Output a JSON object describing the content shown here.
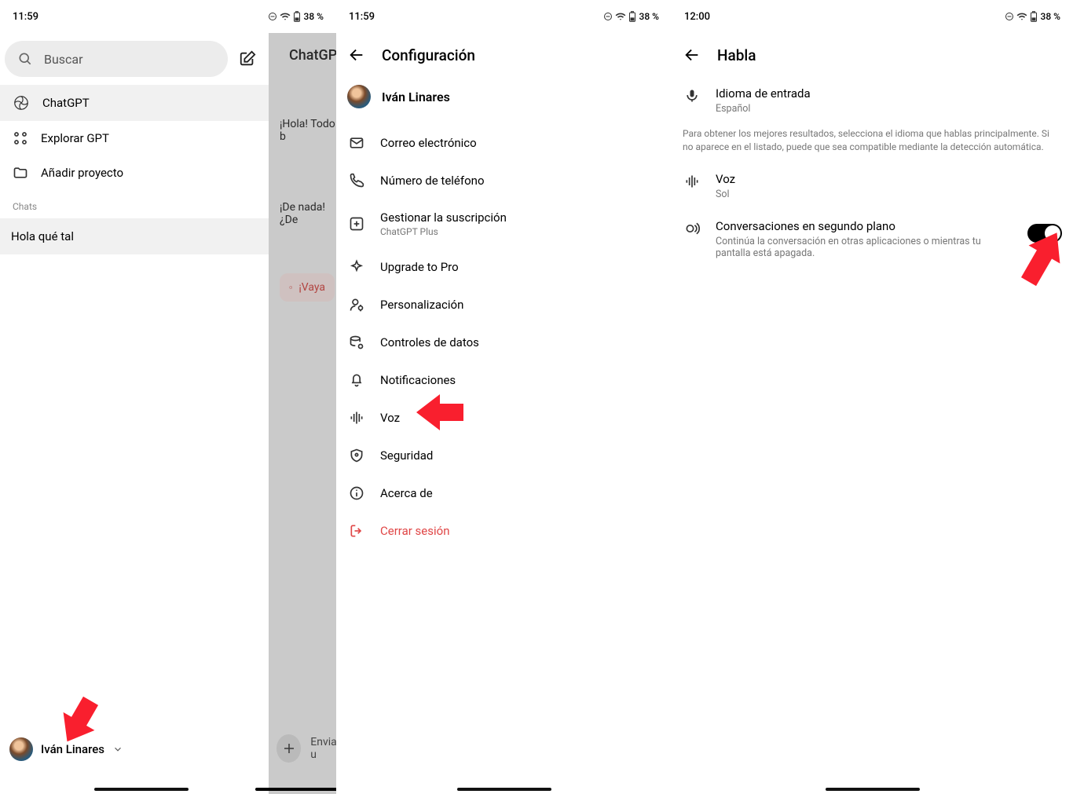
{
  "status": {
    "time1": "11:59",
    "time2": "11:59",
    "time3": "12:00",
    "battery": "38 %"
  },
  "screen1": {
    "search_placeholder": "Buscar",
    "nav": {
      "chatgpt": "ChatGPT",
      "explore": "Explorar GPT",
      "add_project": "Añadir proyecto"
    },
    "chats_label": "Chats",
    "chat_items": [
      "Hola qué tal"
    ],
    "user_name": "Iván Linares",
    "peek": {
      "header": "ChatGPT",
      "msg1": "¡Hola! Todo b",
      "msg2": "¡De nada! ¿De",
      "error": "¡Vaya",
      "input_placeholder": "Enviar u"
    }
  },
  "screen2": {
    "title": "Configuración",
    "user_name": "Iván Linares",
    "items": {
      "email": "Correo electrónico",
      "phone": "Número de teléfono",
      "subscription": "Gestionar la suscripción",
      "subscription_sub": "ChatGPT Plus",
      "upgrade": "Upgrade to Pro",
      "personalization": "Personalización",
      "data_controls": "Controles de datos",
      "notifications": "Notificaciones",
      "voice": "Voz",
      "security": "Seguridad",
      "about": "Acerca de",
      "logout": "Cerrar sesión"
    }
  },
  "screen3": {
    "title": "Habla",
    "input_lang_title": "Idioma de entrada",
    "input_lang_value": "Español",
    "info": "Para obtener los mejores resultados, selecciona el idioma que hablas principalmente. Si no aparece en el listado, puede que sea compatible mediante la detección automática.",
    "voice_title": "Voz",
    "voice_value": "Sol",
    "bg_title": "Conversaciones en segundo plano",
    "bg_sub": "Continúa la conversación en otras aplicaciones o mientras tu pantalla está apagada.",
    "bg_enabled": true
  }
}
